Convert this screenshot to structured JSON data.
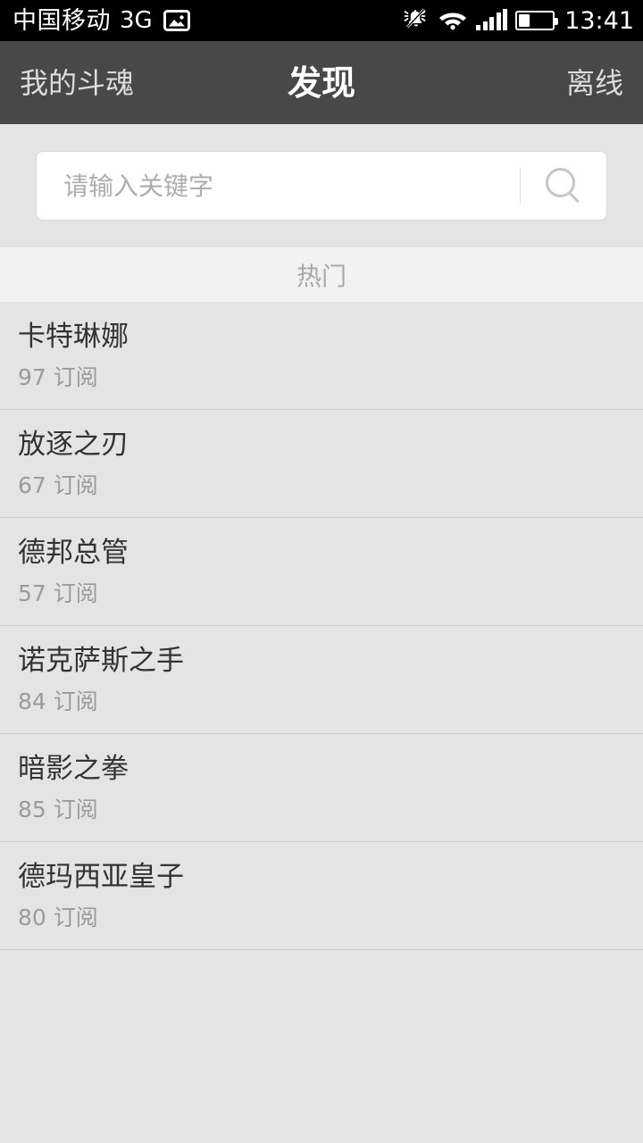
{
  "status_bar": {
    "carrier": "中国移动",
    "network": "3G",
    "screenshot_icon": "image-icon",
    "mute_icon": "bell-muted-icon",
    "wifi_icon": "wifi-icon",
    "signal_icon": "signal-bars-icon",
    "battery_icon": "battery-icon",
    "battery_percent": 32,
    "time": "13:41"
  },
  "navbar": {
    "left_label": "我的斗魂",
    "title": "发现",
    "right_label": "离线"
  },
  "search": {
    "value": "",
    "placeholder": "请输入关键字",
    "icon": "search-icon"
  },
  "section": {
    "header": "热门"
  },
  "list": {
    "items": [
      {
        "title": "卡特琳娜",
        "subtitle": "97 订阅"
      },
      {
        "title": "放逐之刃",
        "subtitle": "67 订阅"
      },
      {
        "title": "德邦总管",
        "subtitle": "57 订阅"
      },
      {
        "title": "诺克萨斯之手",
        "subtitle": "84 订阅"
      },
      {
        "title": "暗影之拳",
        "subtitle": "85 订阅"
      },
      {
        "title": "德玛西亚皇子",
        "subtitle": "80 订阅"
      }
    ]
  },
  "colors": {
    "status_bar_bg": "#000000",
    "navbar_bg": "#484848",
    "page_bg": "#e4e4e4",
    "section_bg": "#f2f2f2",
    "row_bg": "#e4e4e4",
    "divider": "#cfcfcf",
    "title_text": "#333333",
    "subtitle_text": "#9b9b9b",
    "placeholder_text": "#adadad"
  }
}
